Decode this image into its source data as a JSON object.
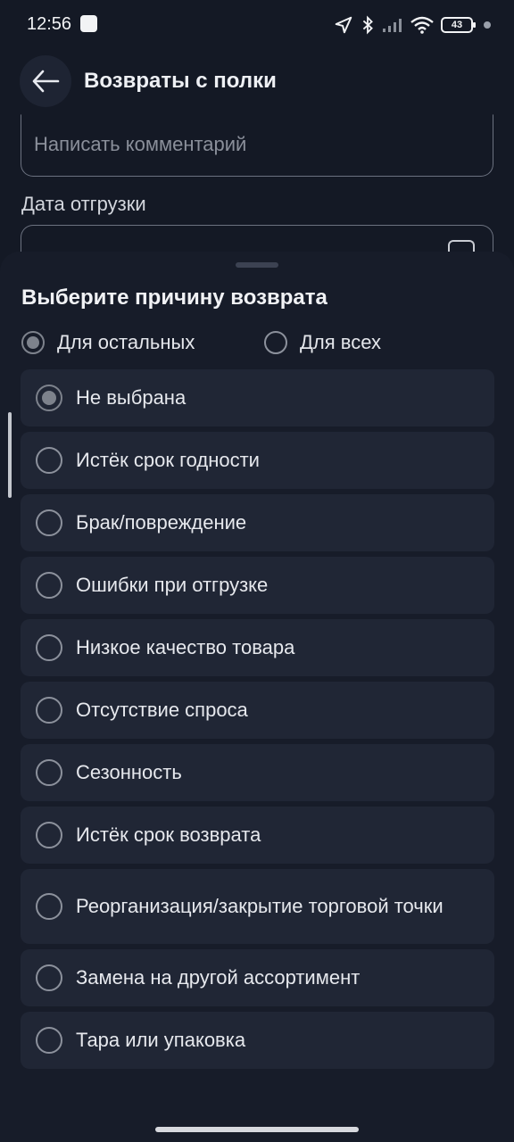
{
  "status_bar": {
    "time": "12:56",
    "battery": "43"
  },
  "header": {
    "title": "Возвраты с полки"
  },
  "form": {
    "comment_placeholder": "Написать комментарий",
    "ship_date_label": "Дата отгрузки"
  },
  "sheet": {
    "title": "Выберите причину возврата",
    "scope_options": [
      {
        "label": "Для остальных",
        "selected": true
      },
      {
        "label": "Для всех",
        "selected": false
      }
    ],
    "reasons": [
      {
        "label": "Не выбрана",
        "selected": true
      },
      {
        "label": "Истёк срок годности",
        "selected": false
      },
      {
        "label": "Брак/повреждение",
        "selected": false
      },
      {
        "label": "Ошибки при отгрузке",
        "selected": false
      },
      {
        "label": "Низкое качество товара",
        "selected": false
      },
      {
        "label": "Отсутствие спроса",
        "selected": false
      },
      {
        "label": "Сезонность",
        "selected": false
      },
      {
        "label": "Истёк срок возврата",
        "selected": false
      },
      {
        "label": "Реорганизация/закрытие торговой точки",
        "selected": false
      },
      {
        "label": "Замена на другой ассортимент",
        "selected": false
      },
      {
        "label": "Тара или упаковка",
        "selected": false
      }
    ]
  },
  "colors": {
    "background": "#141925",
    "sheet": "#171c29",
    "item": "#202635",
    "radio_selected": "#7d828c"
  }
}
